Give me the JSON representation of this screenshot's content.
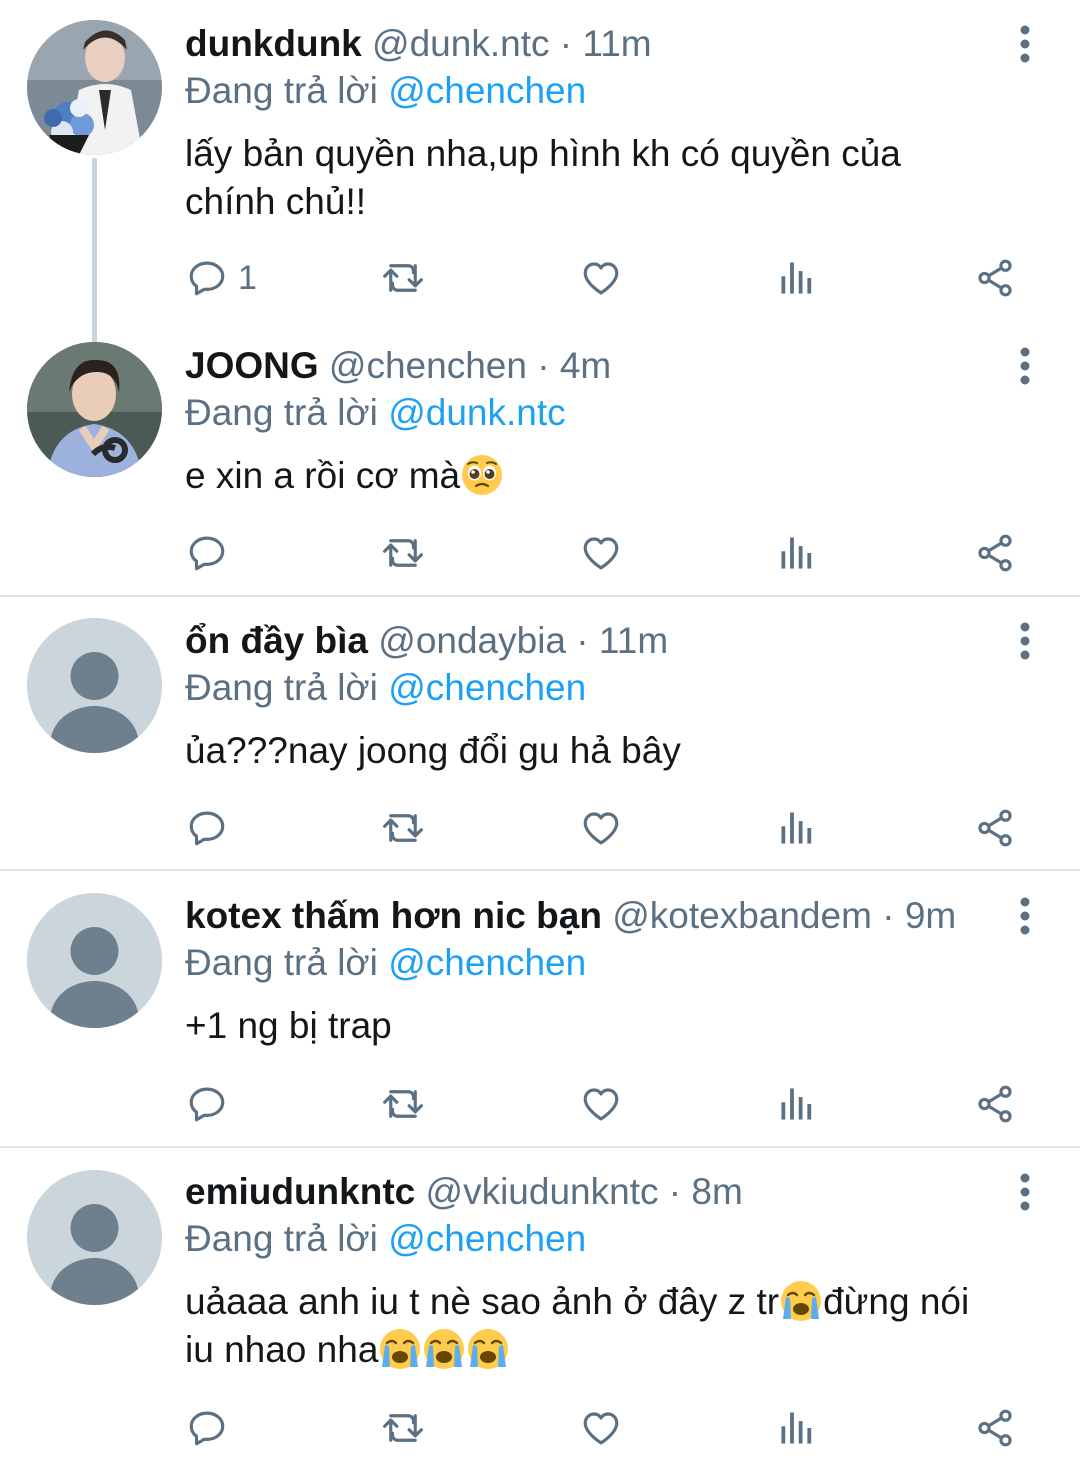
{
  "replying_prefix": "Đang trả lời",
  "colors": {
    "accent": "#1da1f2",
    "secondary_text": "#5b7083",
    "primary_text": "#14171a",
    "separator": "#dfe3e6",
    "thread_line": "#c9d2d9",
    "default_avatar_bg": "#cbd5dc",
    "default_avatar_fg": "#6e7f8d"
  },
  "tweets": [
    {
      "display_name": "dunkdunk",
      "handle": "@dunk.ntc",
      "time": "11m",
      "reply_to": "@chenchen",
      "text_before": "lấy bản quyền nha,up hình kh có quyền của chính chủ!!",
      "emojis": [],
      "text_after": "",
      "trailing_emojis": [],
      "reply_count": "1",
      "avatar": "photo-bouquet"
    },
    {
      "display_name": "JOONG",
      "handle": "@chenchen",
      "time": "4m",
      "reply_to": "@dunk.ntc",
      "text_before": "e xin a rồi cơ mà",
      "emojis": [
        "pleading-face"
      ],
      "text_after": "",
      "trailing_emojis": [],
      "reply_count": "",
      "avatar": "photo-portrait"
    },
    {
      "display_name": "ổn đầy bìa",
      "handle": "@ondaybia",
      "time": "11m",
      "reply_to": "@chenchen",
      "text_before": "ủa???nay joong đổi gu hả bây",
      "emojis": [],
      "text_after": "",
      "trailing_emojis": [],
      "reply_count": "",
      "avatar": "default"
    },
    {
      "display_name": "kotex thấm hơn nic bạn",
      "handle": "@kotexbandem",
      "time": "9m",
      "reply_to": "@chenchen",
      "text_before": "+1 ng bị trap",
      "emojis": [],
      "text_after": "",
      "trailing_emojis": [],
      "reply_count": "",
      "avatar": "default"
    },
    {
      "display_name": "emiudunkntc",
      "handle": "@vkiudunkntc",
      "time": "8m",
      "reply_to": "@chenchen",
      "text_before": "uảaaa anh iu t nè sao ảnh ở đây z tr",
      "emojis": [
        "loudly-crying-face"
      ],
      "text_after": "đừng nói iu nhao nha",
      "trailing_emojis": [
        "loudly-crying-face",
        "loudly-crying-face",
        "loudly-crying-face"
      ],
      "reply_count": "",
      "avatar": "default"
    }
  ],
  "icons": {
    "reply": "reply-icon",
    "retweet": "retweet-icon",
    "like": "like-icon",
    "analytics": "analytics-icon",
    "share": "share-icon",
    "more": "more-options-icon"
  }
}
